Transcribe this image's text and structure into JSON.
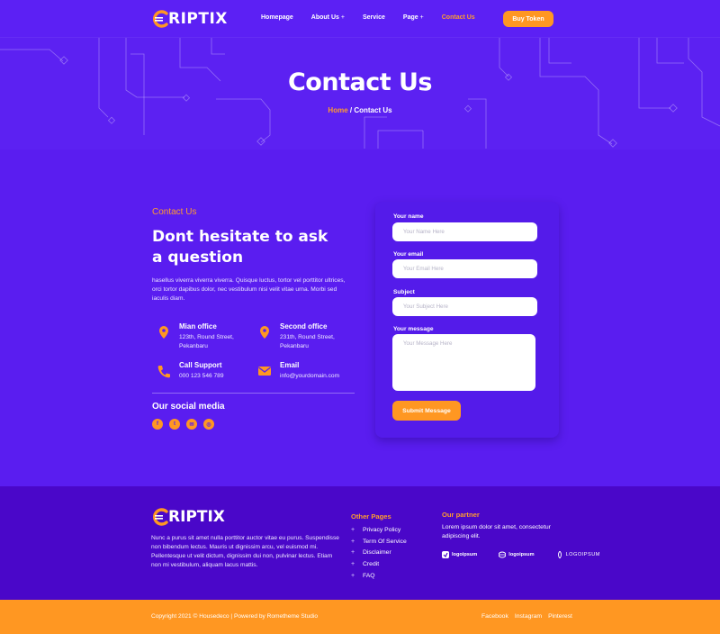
{
  "brand": {
    "name": "CRIPTIX",
    "name_tail": "RIPTIX"
  },
  "nav": {
    "items": [
      {
        "label": "Homepage",
        "has_plus": false
      },
      {
        "label": "About Us",
        "has_plus": true
      },
      {
        "label": "Service",
        "has_plus": false
      },
      {
        "label": "Page",
        "has_plus": true
      },
      {
        "label": "Contact Us",
        "has_plus": false,
        "active": true
      }
    ],
    "plus": "+",
    "buy_label": "Buy Token"
  },
  "hero": {
    "title": "Contact Us",
    "breadcrumb_home": "Home",
    "breadcrumb_sep": " / ",
    "breadcrumb_current": "Contact Us"
  },
  "contact": {
    "eyebrow": "Contact Us",
    "heading_line1": "Dont hesitate to ask",
    "heading_line2": "a question",
    "paragraph": "hasellus viverra viverra viverra. Quisque luctus, tortor vel porttitor ultrices, orci tortor dapibus dolor, nec vestibulum nisi velit vitae urna. Morbi sed iaculis diam.",
    "items": [
      {
        "title": "Mian office",
        "line1": "123th, Round Street,",
        "line2": "Pekanbaru",
        "icon": "map-pin-icon"
      },
      {
        "title": "Second office",
        "line1": "231th, Round Street,",
        "line2": "Pekanbaru",
        "icon": "map-pin-icon"
      },
      {
        "title": "Call Support",
        "line1": "000 123 546 789",
        "line2": "",
        "icon": "phone-icon"
      },
      {
        "title": "Email",
        "line1": "info@yourdomain.com",
        "line2": "",
        "icon": "envelope-icon"
      }
    ],
    "social_title": "Our social media",
    "socials": [
      "facebook-icon",
      "twitter-icon",
      "email-icon",
      "instagram-icon"
    ]
  },
  "form": {
    "name_label": "Your name",
    "name_placeholder": "Your Name Here",
    "email_label": "Your email",
    "email_placeholder": "Your Email Here",
    "subject_label": "Subject",
    "subject_placeholder": "Your Subject Here",
    "message_label": "Your message",
    "message_placeholder": "Your Message Here",
    "submit_label": "Submit Message"
  },
  "footer": {
    "description": "Nunc a purus sit amet nulla porttitor auctor vitae eu purus. Suspendisse non bibendum lectus. Mauris ut dignissim arcu, vel euismod mi. Pellentesque ut velit dictum, dignissim dui non, pulvinar lectus. Etiam non mi vestibulum, aliquam lacus mattis.",
    "other_pages_title": "Other Pages",
    "other_pages": [
      "Privacy Policy",
      "Term Of Service",
      "Disclaimer",
      "Credit",
      "FAQ"
    ],
    "partner_title": "Our partner",
    "partner_text": "Lorem ipsum dolor sit amet, consectetur adipiscing elit.",
    "partner_logos": [
      "logoipsum",
      "logoipsum",
      "LOGOIPSUM"
    ],
    "copyright": "Copyright 2021 © Housedeco | Powered by Rometheme Studio",
    "bottom_links": [
      "Facebook",
      "Instagram",
      "Pinterest"
    ]
  },
  "colors": {
    "primary": "#5a1df0",
    "accent": "#ff9722",
    "footer": "#4a07c9"
  }
}
